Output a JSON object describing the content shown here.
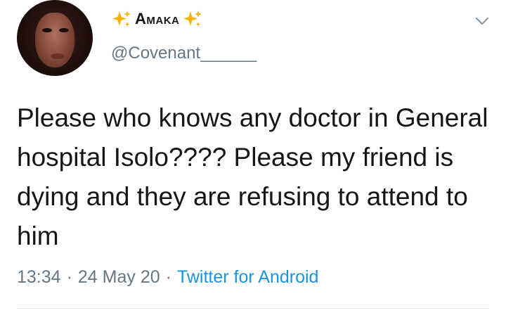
{
  "user": {
    "display_name": "Amaka",
    "handle": "@Covenant______",
    "name_decoration_icon": "sparkles-icon",
    "name_decoration_color": "#f5b301"
  },
  "tweet": {
    "text": "Please who knows any doctor in General hospital Isolo???? Please my friend is dying and they are refusing to attend to him",
    "time": "13:34",
    "date": "24 May 20",
    "separator": "·",
    "source": "Twitter for Android"
  },
  "icons": {
    "menu": "chevron-down-icon"
  },
  "colors": {
    "text": "#14171a",
    "secondary": "#657786",
    "link": "#1b95e0",
    "divider": "#e1e8ed"
  }
}
